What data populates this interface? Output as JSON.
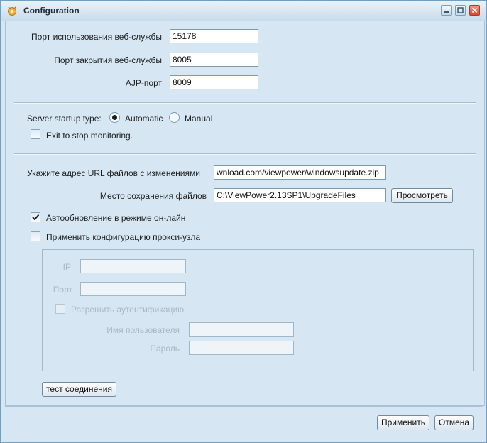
{
  "window": {
    "title": "Configuration"
  },
  "web": {
    "port_label": "Порт использования веб-службы",
    "port_value": "15178",
    "shutdown_label": "Порт закрытия веб-службы",
    "shutdown_value": "8005",
    "ajp_label": "AJP-порт",
    "ajp_value": "8009"
  },
  "startup": {
    "label": "Server startup type:",
    "options": [
      "Automatic",
      "Manual"
    ],
    "selected": "Automatic",
    "exit_label": "Exit to stop monitoring."
  },
  "update": {
    "url_label": "Укажите адрес URL файлов с изменениями",
    "url_value": "wnload.com/viewpower/windowsupdate.zip",
    "path_label": "Место сохранения файлов",
    "path_value": "C:\\ViewPower2.13SP1\\UpgradeFiles",
    "browse_label": "Просмотреть",
    "auto_update_label": "Автообновление в режиме он-лайн",
    "auto_update_checked": true,
    "proxy_label": "Применить конфигурацию прокси-узла",
    "proxy_checked": false
  },
  "proxy": {
    "ip_label": "IP",
    "port_label": "Порт",
    "auth_label": "Разрешить аутентификацию",
    "user_label": "Имя пользователя",
    "password_label": "Пароль"
  },
  "test_button_label": "тест соединения",
  "footer": {
    "apply_label": "Применить",
    "cancel_label": "Отмена"
  }
}
